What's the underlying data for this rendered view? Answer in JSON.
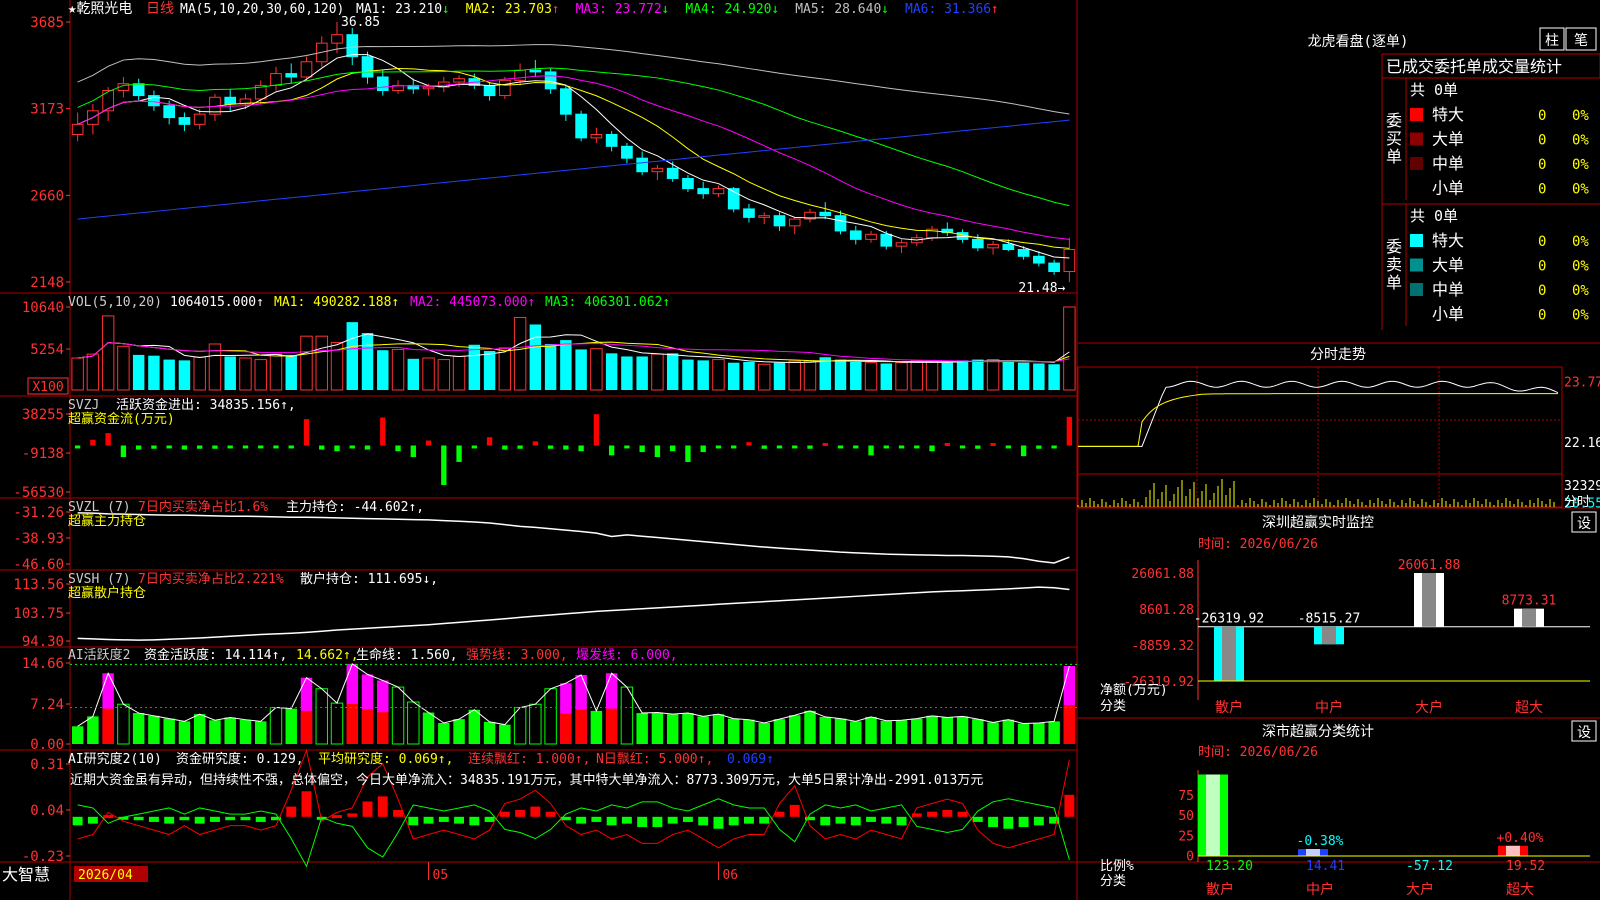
{
  "colors": {
    "up": "#ff3232",
    "down": "#00ffff",
    "ma1": "#ffffff",
    "ma2": "#ffff00",
    "ma3": "#ff00ff",
    "ma4": "#00ff00",
    "ma5": "#c0c0c0",
    "ma6": "#2040ff",
    "grid": "#b00000",
    "axis": "#ff3232",
    "label": "#ffffff",
    "panelBorder": "#b00000"
  },
  "main_chart": {
    "title_star": "★",
    "stock_name": "乾照光电",
    "period": "日线",
    "ma_header": "MA(5,10,20,30,60,120)",
    "ma_items": [
      {
        "label": "MA1: 23.210",
        "arrow": "↓",
        "color": "#ffffff"
      },
      {
        "label": "MA2: 23.703",
        "arrow": "↑",
        "color": "#ffff00"
      },
      {
        "label": "MA3: 23.772",
        "arrow": "↓",
        "color": "#ff00ff"
      },
      {
        "label": "MA4: 24.920",
        "arrow": "↓",
        "color": "#00ff00"
      },
      {
        "label": "MA5: 28.640",
        "arrow": "↓",
        "color": "#c0c0c0"
      },
      {
        "label": "MA6: 31.366",
        "arrow": "↑",
        "color": "#2040ff"
      }
    ],
    "yticks": [
      "3685",
      "3173",
      "2660",
      "2148"
    ],
    "high_label": "36.85",
    "low_label": "21.48→"
  },
  "vol_panel": {
    "header": "VOL(5,10,20)",
    "value": "1064015.000",
    "ma1": "MA1: 490282.188",
    "ma2": "MA2: 445073.000",
    "ma3": "MA3: 406301.062",
    "yticks": [
      "10640",
      "5254"
    ],
    "unit": "X100"
  },
  "svzj_panel": {
    "header": "SVZJ",
    "line1": "活跃资金进出: 34835.156",
    "line2": "超赢资金流(万元)",
    "yticks": [
      "38255",
      "-9138",
      "-56530"
    ]
  },
  "svzl_panel": {
    "header": "SVZL (7)",
    "ratio": "7日内买卖净占比1.6%",
    "label": "主力持仓: -44.602",
    "line2": "超赢主力持仓",
    "yticks": [
      "-31.26",
      "-38.93",
      "-46.60"
    ]
  },
  "svsh_panel": {
    "header": "SVSH (7)",
    "ratio": "7日内买卖净占比2.221%",
    "label": "散户持仓: 111.695",
    "line2": "超赢散户持仓",
    "yticks": [
      "113.56",
      "103.75",
      "94.30"
    ]
  },
  "ai_active_panel": {
    "header": "AI活跃度2",
    "a": "资金活跃度: 14.114",
    "b": "14.662",
    "c": "生命线: 1.560",
    "d": "强势线: 3.000",
    "e": "爆发线: 6.000",
    "yticks": [
      "14.66",
      "7.24",
      "0.00"
    ]
  },
  "ai_research_panel": {
    "header": "AI研究度2(10)",
    "a": "资金研究度: 0.129",
    "b": "平均研究度: 0.069",
    "c": "连续飘红: 1.000",
    "d": "N日飘红: 5.000",
    "e": "0.069",
    "note": "近期大资金虽有异动，但持续性不强，总体偏空，今日大单净流入：34835.191万元，其中特大单净流入：8773.309万元，大单5日累计净出-2991.013万元",
    "yticks": [
      "0.31",
      "0.04",
      "-0.23"
    ]
  },
  "x_axis": {
    "dates": [
      "2026/04",
      "05",
      "06"
    ]
  },
  "status": {
    "brand": "大智慧"
  },
  "right": {
    "longhu": {
      "title": "龙虎看盘(逐单)",
      "btn_zhu": "柱",
      "btn_bi": "笔",
      "tabs": "已成交委托单成交量统计",
      "buy_label": "委买单",
      "sell_label": "委卖单",
      "buy_total": "共 0单",
      "sell_total": "共 0单",
      "rows_buy": [
        {
          "name": "特大",
          "count": "0",
          "pct": "0%",
          "color": "#ff0000"
        },
        {
          "name": "大单",
          "count": "0",
          "pct": "0%",
          "color": "#8b0000"
        },
        {
          "name": "中单",
          "count": "0",
          "pct": "0%",
          "color": "#600000"
        },
        {
          "name": "小单",
          "count": "0",
          "pct": "0%",
          "color": ""
        }
      ],
      "rows_sell": [
        {
          "name": "特大",
          "count": "0",
          "pct": "0%",
          "color": "#00ffff"
        },
        {
          "name": "大单",
          "count": "0",
          "pct": "0%",
          "color": "#009090"
        },
        {
          "name": "中单",
          "count": "0",
          "pct": "0%",
          "color": "#007070"
        },
        {
          "name": "小单",
          "count": "0",
          "pct": "0%",
          "color": ""
        }
      ]
    },
    "fenshi": {
      "title": "分时走势",
      "yticks": [
        "23.77",
        "22.16",
        "20.55"
      ],
      "vol_label": "32329",
      "vol_unit": "分时"
    },
    "sz_monitor": {
      "title": "深圳超赢实时监控",
      "btn": "设",
      "time": "时间: 2026/06/26",
      "yticks": [
        "26061.88",
        "8601.28",
        "-8859.32",
        "-26319.92"
      ],
      "ylabel": "净额(万元)",
      "xlabel": "分类",
      "categories": [
        "散户",
        "中户",
        "大户",
        "超大"
      ],
      "values": [
        -26319.92,
        -8515.27,
        26061.88,
        8773.31
      ],
      "value_labels": [
        "-26319.92",
        "-8515.27",
        "26061.88",
        "8773.31"
      ]
    },
    "sz_class": {
      "title": "深市超赢分类统计",
      "btn": "设",
      "time": "时间: 2026/06/26",
      "yticks": [
        "75",
        "50",
        "25",
        "0"
      ],
      "ylabel": "比例%",
      "xlabel": "分类",
      "categories": [
        "散户",
        "中户",
        "大户",
        "超大"
      ],
      "pct_labels": [
        "",
        "-0.38%",
        "",
        "+0.40%"
      ],
      "values": [
        "123.20",
        "14.41",
        "-57.12",
        "19.52"
      ]
    }
  },
  "chart_data": [
    {
      "type": "candlestick",
      "title": "乾照光电 日线",
      "ylim": [
        21.48,
        36.85
      ],
      "ohlc": [
        [
          30.2,
          31.5,
          29.8,
          30.8
        ],
        [
          30.8,
          32.0,
          30.2,
          31.6
        ],
        [
          31.6,
          33.0,
          31.0,
          32.8
        ],
        [
          32.8,
          33.6,
          32.4,
          33.2
        ],
        [
          33.2,
          33.5,
          32.2,
          32.5
        ],
        [
          32.5,
          32.8,
          31.6,
          31.9
        ],
        [
          31.9,
          32.2,
          30.8,
          31.2
        ],
        [
          31.2,
          31.5,
          30.4,
          30.8
        ],
        [
          30.8,
          31.7,
          30.5,
          31.4
        ],
        [
          31.4,
          32.6,
          31.0,
          32.4
        ],
        [
          32.4,
          32.9,
          31.6,
          32.0
        ],
        [
          32.0,
          32.6,
          31.7,
          32.3
        ],
        [
          32.3,
          33.4,
          32.0,
          33.1
        ],
        [
          33.1,
          34.2,
          32.8,
          33.8
        ],
        [
          33.8,
          34.4,
          33.2,
          33.6
        ],
        [
          33.6,
          34.8,
          33.4,
          34.5
        ],
        [
          34.5,
          36.0,
          34.2,
          35.6
        ],
        [
          35.6,
          36.85,
          35.0,
          36.1
        ],
        [
          36.1,
          36.5,
          34.3,
          34.8
        ],
        [
          34.8,
          35.1,
          33.2,
          33.6
        ],
        [
          33.6,
          34.0,
          32.5,
          32.8
        ],
        [
          32.8,
          33.4,
          32.6,
          33.1
        ],
        [
          33.1,
          33.5,
          32.6,
          32.9
        ],
        [
          32.9,
          33.2,
          32.5,
          33.0
        ],
        [
          33.0,
          33.6,
          32.7,
          33.3
        ],
        [
          33.3,
          33.7,
          33.0,
          33.5
        ],
        [
          33.5,
          33.8,
          32.9,
          33.1
        ],
        [
          33.1,
          33.3,
          32.2,
          32.5
        ],
        [
          32.5,
          33.6,
          32.3,
          33.4
        ],
        [
          33.4,
          34.4,
          33.1,
          34.0
        ],
        [
          34.0,
          34.6,
          33.6,
          33.9
        ],
        [
          33.9,
          34.1,
          32.6,
          32.9
        ],
        [
          32.9,
          33.1,
          31.0,
          31.4
        ],
        [
          31.4,
          31.6,
          29.8,
          30.0
        ],
        [
          30.0,
          30.6,
          29.7,
          30.2
        ],
        [
          30.2,
          30.4,
          29.2,
          29.5
        ],
        [
          29.5,
          29.7,
          28.5,
          28.8
        ],
        [
          28.8,
          29.2,
          27.8,
          28.0
        ],
        [
          28.0,
          28.4,
          27.5,
          28.2
        ],
        [
          28.2,
          28.6,
          27.4,
          27.6
        ],
        [
          27.6,
          27.8,
          26.8,
          27.0
        ],
        [
          27.0,
          27.4,
          26.4,
          26.7
        ],
        [
          26.7,
          27.2,
          26.5,
          27.0
        ],
        [
          27.0,
          27.1,
          25.6,
          25.8
        ],
        [
          25.8,
          26.1,
          25.0,
          25.3
        ],
        [
          25.3,
          25.6,
          24.9,
          25.4
        ],
        [
          25.4,
          25.6,
          24.5,
          24.8
        ],
        [
          24.8,
          25.3,
          24.3,
          25.2
        ],
        [
          25.2,
          25.8,
          25.0,
          25.6
        ],
        [
          25.6,
          26.2,
          25.2,
          25.4
        ],
        [
          25.4,
          25.7,
          24.3,
          24.5
        ],
        [
          24.5,
          24.8,
          23.7,
          24.0
        ],
        [
          24.0,
          24.5,
          23.8,
          24.3
        ],
        [
          24.3,
          24.5,
          23.4,
          23.6
        ],
        [
          23.6,
          24.0,
          23.2,
          23.8
        ],
        [
          23.8,
          24.3,
          23.6,
          24.1
        ],
        [
          24.1,
          24.8,
          23.9,
          24.6
        ],
        [
          24.6,
          25.0,
          24.2,
          24.4
        ],
        [
          24.4,
          24.6,
          23.8,
          24.0
        ],
        [
          24.0,
          24.3,
          23.3,
          23.5
        ],
        [
          23.5,
          23.9,
          23.1,
          23.7
        ],
        [
          23.7,
          24.0,
          23.3,
          23.4
        ],
        [
          23.4,
          23.6,
          22.8,
          23.0
        ],
        [
          23.0,
          23.3,
          22.4,
          22.6
        ],
        [
          22.6,
          22.8,
          21.9,
          22.1
        ],
        [
          22.1,
          24.1,
          21.48,
          23.4
        ]
      ]
    },
    {
      "type": "bar",
      "title": "VOL",
      "ylim": [
        0,
        10640
      ],
      "values": [
        4100,
        4600,
        9500,
        5600,
        4500,
        4400,
        3900,
        3800,
        4200,
        5900,
        4300,
        4100,
        3900,
        4600,
        4500,
        6900,
        6900,
        6100,
        8700,
        7300,
        5100,
        5200,
        4000,
        4100,
        3900,
        4300,
        5800,
        5000,
        5400,
        9300,
        8400,
        5900,
        6400,
        5200,
        5300,
        4700,
        4300,
        4300,
        4600,
        4700,
        3900,
        3800,
        3900,
        3500,
        3600,
        3300,
        3500,
        3700,
        3700,
        4200,
        3900,
        3600,
        3500,
        3400,
        3500,
        3700,
        3600,
        3500,
        3800,
        3900,
        3900,
        3600,
        3500,
        3400,
        3300,
        10640
      ]
    },
    {
      "type": "bar",
      "title": "超赢资金流(万元)",
      "ylim": [
        -56530,
        38255
      ],
      "values": [
        -3000,
        7000,
        15000,
        -14000,
        -5000,
        -4000,
        -3000,
        -5000,
        -4000,
        -4000,
        -3000,
        -3000,
        -2000,
        -3000,
        -2000,
        32000,
        -5000,
        -7000,
        -2000,
        -5000,
        34000,
        -7000,
        -14000,
        6000,
        -48000,
        -20000,
        -3000,
        10000,
        -5000,
        -4000,
        5000,
        -4000,
        -5000,
        -7000,
        38000,
        -12000,
        -3000,
        -8000,
        -14000,
        -7000,
        -20000,
        -8000,
        -3000,
        -2000,
        4000,
        -4000,
        -3000,
        -2000,
        -4000,
        3000,
        -3000,
        -2000,
        -12000,
        -3000,
        -2000,
        -3000,
        -7000,
        3000,
        -3000,
        -4000,
        3000,
        -3000,
        -13000,
        -4000,
        -3000,
        34835
      ]
    },
    {
      "type": "line",
      "title": "超赢主力持仓",
      "ylim": [
        -46.6,
        -31.26
      ],
      "values": [
        -31.5,
        -31.6,
        -31.8,
        -31.9,
        -32.0,
        -32.1,
        -32.2,
        -32.2,
        -32.3,
        -32.4,
        -32.5,
        -32.5,
        -32.6,
        -32.7,
        -32.8,
        -32.8,
        -32.9,
        -33.0,
        -33.1,
        -33.2,
        -33.3,
        -33.4,
        -33.5,
        -33.6,
        -33.8,
        -34.0,
        -34.2,
        -34.5,
        -35.0,
        -35.5,
        -35.8,
        -36.2,
        -36.6,
        -37.0,
        -37.5,
        -38.5,
        -38.0,
        -38.4,
        -38.8,
        -39.2,
        -39.6,
        -40.0,
        -40.4,
        -40.8,
        -41.2,
        -41.6,
        -41.9,
        -42.2,
        -42.5,
        -42.8,
        -43.1,
        -43.3,
        -43.5,
        -43.7,
        -43.8,
        -43.9,
        -44.0,
        -44.1,
        -44.1,
        -44.2,
        -44.3,
        -44.5,
        -45.0,
        -45.8,
        -46.3,
        -44.6
      ]
    },
    {
      "type": "line",
      "title": "超赢散户持仓",
      "ylim": [
        94.3,
        113.56
      ],
      "values": [
        95.2,
        95.0,
        94.8,
        94.7,
        94.6,
        94.7,
        94.9,
        95.1,
        95.3,
        95.6,
        95.9,
        96.2,
        96.5,
        96.7,
        96.9,
        97.2,
        97.6,
        98.0,
        98.3,
        98.6,
        98.9,
        99.2,
        99.5,
        99.8,
        100.2,
        100.6,
        101.0,
        101.4,
        101.8,
        102.3,
        102.7,
        103.1,
        103.5,
        103.9,
        104.3,
        104.6,
        104.9,
        105.2,
        105.5,
        105.8,
        106.1,
        106.4,
        106.7,
        107.0,
        107.3,
        107.6,
        107.9,
        108.2,
        108.5,
        108.8,
        109.1,
        109.4,
        109.7,
        110.0,
        110.3,
        110.6,
        110.9,
        111.1,
        111.3,
        111.5,
        111.7,
        111.9,
        112.2,
        112.5,
        112.3,
        111.695
      ]
    },
    {
      "type": "bar",
      "title": "AI活跃度2",
      "ylim": [
        0,
        14.66
      ],
      "values": [
        3.2,
        5.0,
        12.8,
        7.2,
        5.6,
        5.1,
        4.6,
        4.1,
        5.4,
        4.3,
        4.8,
        4.4,
        4.1,
        6.6,
        6.4,
        12.0,
        10.0,
        7.4,
        14.5,
        12.6,
        11.5,
        10.3,
        7.6,
        5.7,
        3.8,
        4.5,
        6.2,
        4.0,
        3.5,
        6.6,
        7.2,
        10.0,
        11.0,
        12.5,
        6.0,
        12.8,
        10.3,
        5.6,
        5.7,
        5.4,
        5.6,
        5.0,
        5.4,
        4.6,
        4.4,
        3.8,
        4.5,
        5.2,
        6.0,
        4.9,
        4.6,
        4.1,
        4.9,
        4.2,
        4.3,
        4.6,
        5.1,
        4.8,
        5.0,
        4.5,
        3.9,
        4.4,
        3.7,
        3.8,
        4.1,
        14.114
      ]
    },
    {
      "type": "bar",
      "title": "AI研究度2(10)",
      "ylim": [
        -0.23,
        0.31
      ],
      "values": [
        -0.05,
        -0.04,
        0.01,
        -0.01,
        -0.02,
        -0.03,
        -0.04,
        -0.02,
        -0.04,
        -0.03,
        -0.02,
        -0.02,
        -0.03,
        -0.02,
        0.06,
        0.15,
        -0.01,
        0.01,
        0.02,
        0.09,
        0.12,
        0.04,
        -0.05,
        -0.04,
        -0.03,
        -0.04,
        -0.05,
        -0.03,
        0.03,
        0.04,
        0.06,
        0.03,
        -0.02,
        -0.04,
        -0.03,
        -0.05,
        -0.04,
        -0.06,
        -0.06,
        -0.04,
        -0.03,
        -0.05,
        -0.07,
        -0.05,
        -0.04,
        -0.04,
        0.03,
        0.07,
        -0.02,
        -0.05,
        -0.04,
        -0.05,
        -0.03,
        -0.04,
        -0.05,
        0.02,
        0.03,
        0.04,
        0.03,
        -0.03,
        -0.06,
        -0.07,
        -0.06,
        -0.05,
        -0.04,
        0.129
      ]
    }
  ]
}
